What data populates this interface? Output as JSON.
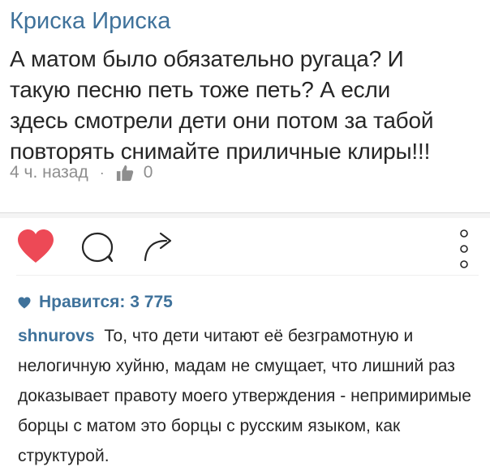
{
  "comment": {
    "author": "Криска Ириска",
    "lines": [
      "А матом было обязательно ругаца? И",
      "такую песню петь тоже петь? А если",
      "здесь смотрели дети они потом за  табой",
      "повторять снимайте приличные клиры!!!"
    ],
    "time": "4 ч. назад",
    "separator": "·",
    "like_count": "0"
  },
  "actions": {
    "heart_icon": "heart-filled-icon",
    "comment_icon": "comment-bubble-icon",
    "share_icon": "share-arrow-icon",
    "more_icon": "more-vertical-icon",
    "heart_color": "#ed4956"
  },
  "post": {
    "likes_label": "Нравится: 3 775",
    "caption_user": "shnurovs",
    "caption_text": "То, что дети читают её безграмотную и нелогичную хуйню, мадам не смущает, что лишний раз доказывает правоту моего утверждения - непримиримые борцы с матом это борцы с русским языком, как структурой."
  },
  "colors": {
    "link_blue": "#3f729b",
    "text_dark": "#262626",
    "meta_gray": "#8e8e8e"
  }
}
